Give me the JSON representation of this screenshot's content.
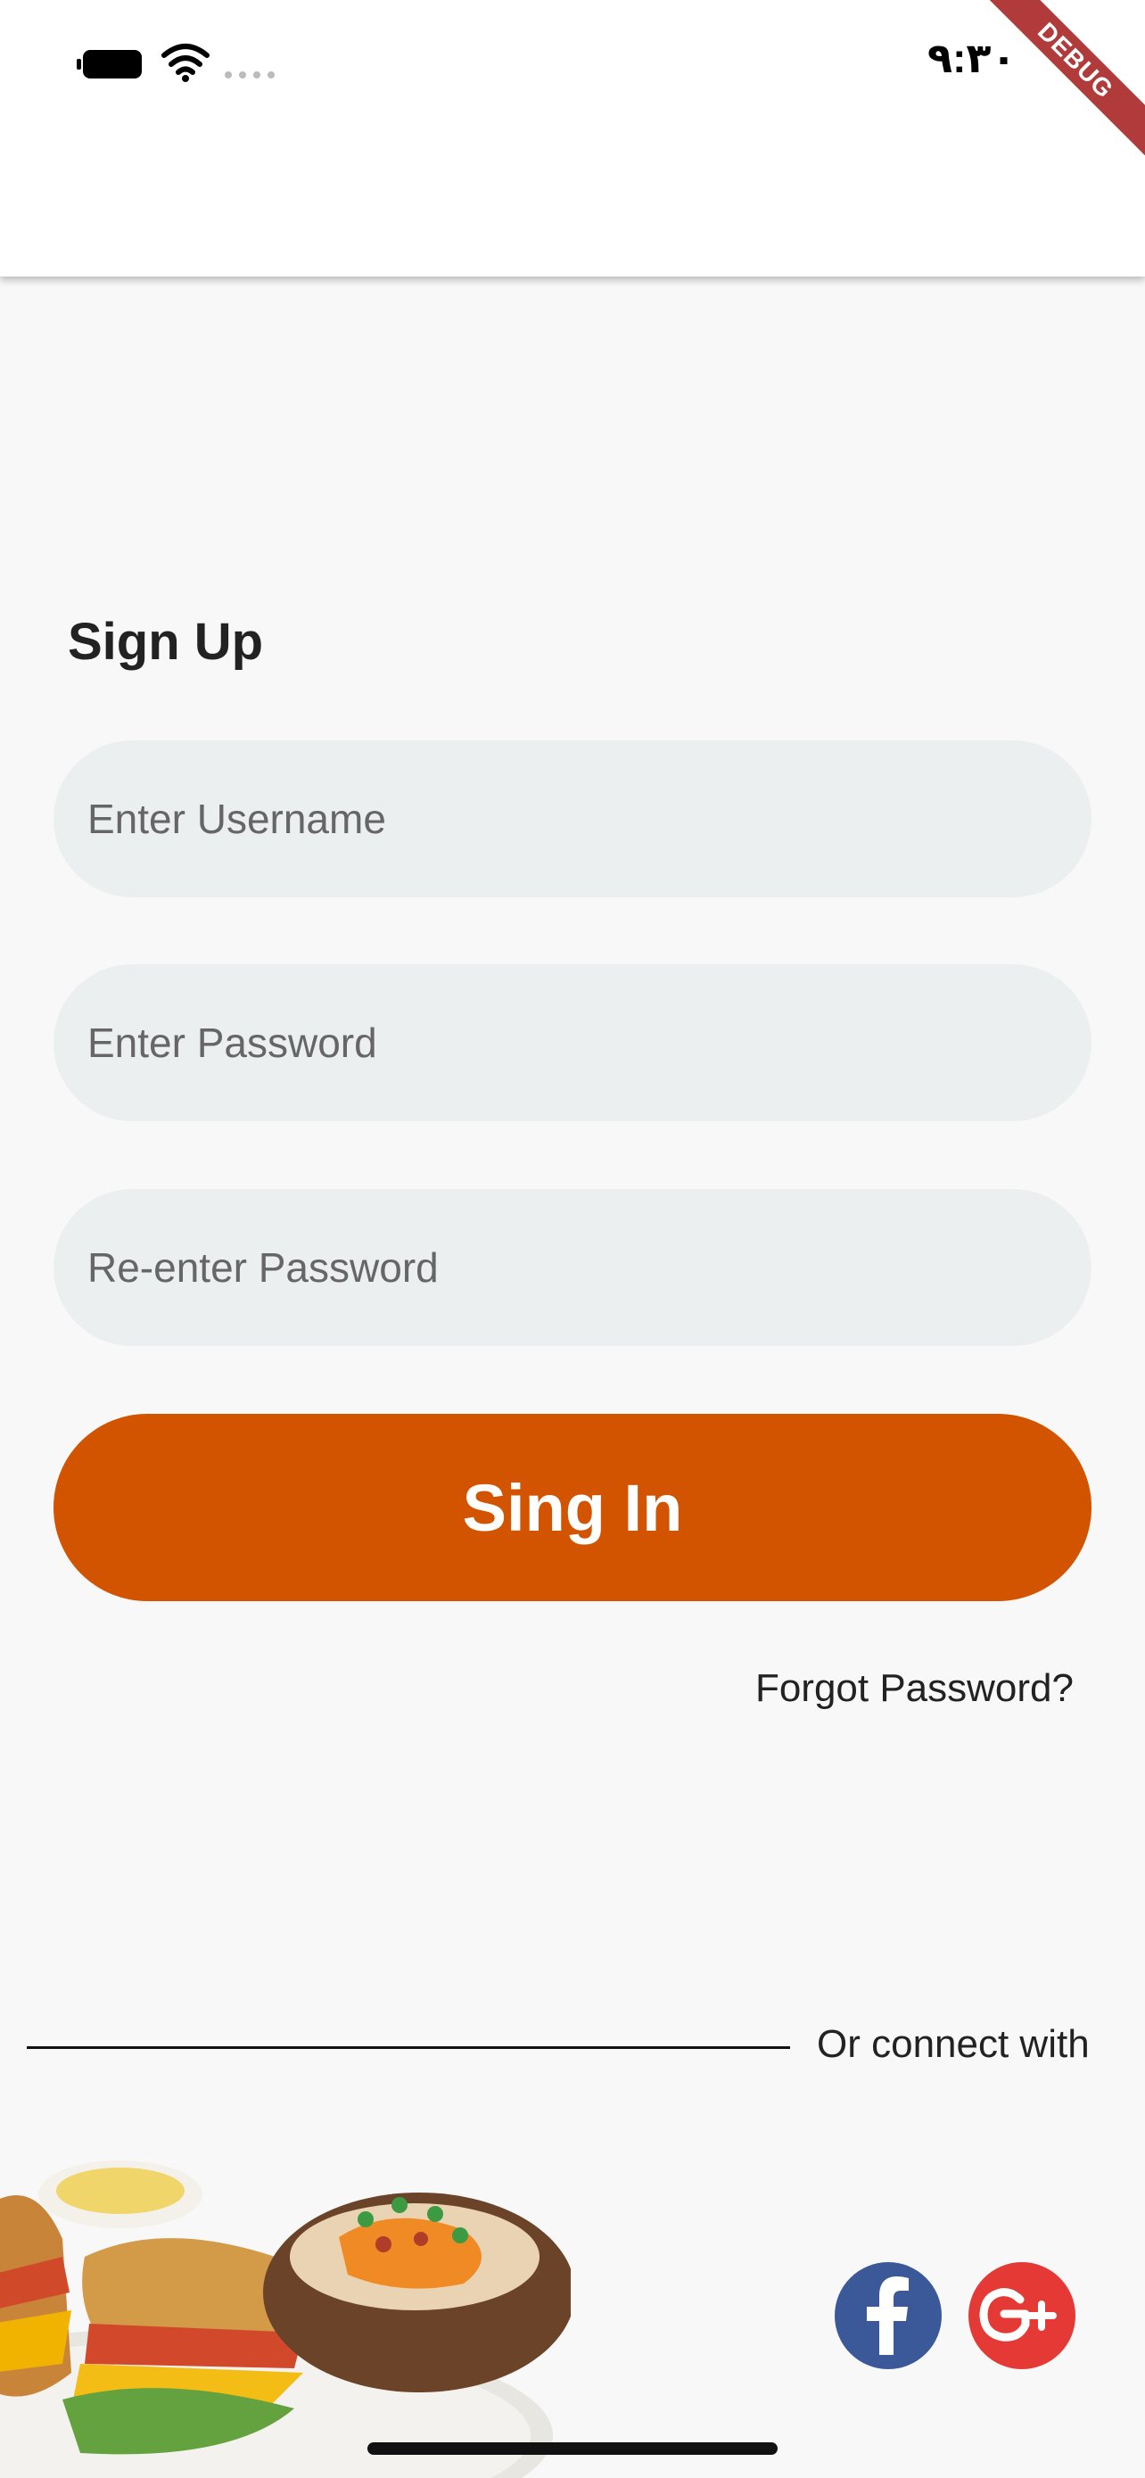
{
  "status_bar": {
    "time": "٩:٣٠",
    "icons": [
      "battery-icon",
      "wifi-icon",
      "signal-icon"
    ],
    "debug_label": "DEBUG",
    "debug_color": "#b13b3b"
  },
  "form": {
    "title": "Sign Up",
    "username_placeholder": "Enter Username",
    "password_placeholder": "Enter Password",
    "reenter_placeholder": "Re-enter Password",
    "submit_label": "Sing In",
    "forgot_label": "Forgot Password?"
  },
  "social": {
    "connect_label": "Or connect with",
    "providers": [
      "facebook-icon",
      "google-plus-icon"
    ]
  },
  "colors": {
    "accent": "#d35400",
    "input_bg": "#eceff0",
    "facebook": "#3b5998",
    "google": "#e53935",
    "background": "#f8f8f8"
  }
}
